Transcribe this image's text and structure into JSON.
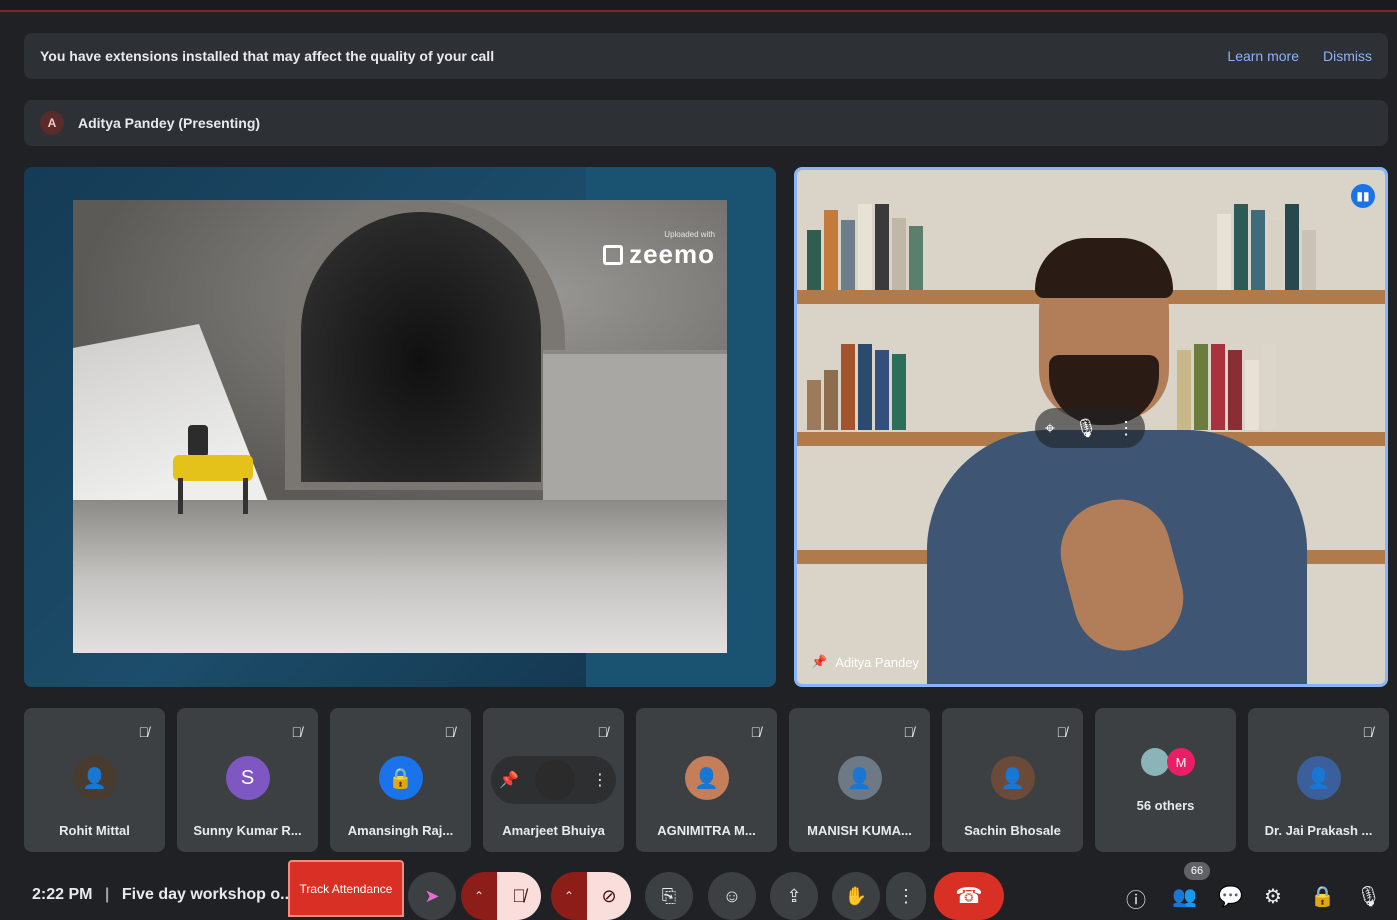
{
  "banner": {
    "message": "You have extensions installed that may affect the quality of your call",
    "learn_more": "Learn more",
    "dismiss": "Dismiss"
  },
  "presenting": {
    "avatar_letter": "A",
    "label": "Aditya Pandey (Presenting)"
  },
  "slide": {
    "watermark_small": "Uploaded with",
    "watermark_brand": "zeemo"
  },
  "camera": {
    "name": "Aditya Pandey"
  },
  "participants": [
    {
      "name": "Rohit Mittal",
      "avatar": "photo",
      "color": "#4a3b2f"
    },
    {
      "name": "Sunny Kumar R...",
      "avatar": "S",
      "color": "#7e57c2"
    },
    {
      "name": "Amansingh Raj...",
      "avatar": "lock",
      "color": "#1a73e8"
    },
    {
      "name": "Amarjeet Bhuiya",
      "avatar": "photo",
      "color": "#2b2b2b"
    },
    {
      "name": "AGNIMITRA M...",
      "avatar": "photo",
      "color": "#c47f5a"
    },
    {
      "name": "MANISH KUMA...",
      "avatar": "photo",
      "color": "#6d7a85"
    },
    {
      "name": "Sachin Bhosale",
      "avatar": "photo",
      "color": "#6b4a3a"
    },
    {
      "name": "56 others",
      "avatar": "M",
      "color": "#e91e63"
    },
    {
      "name": "Dr. Jai Prakash ...",
      "avatar": "photo",
      "color": "#3a5f9a"
    }
  ],
  "bottom": {
    "time": "2:22 PM",
    "separator": "|",
    "meeting_title": "Five day workshop o...",
    "track_attendance": "Track Attendance",
    "participant_count": "66"
  },
  "colors": {
    "accent": "#8ab4f8",
    "danger": "#d93025",
    "tile": "#3c4043",
    "background": "#202124"
  }
}
